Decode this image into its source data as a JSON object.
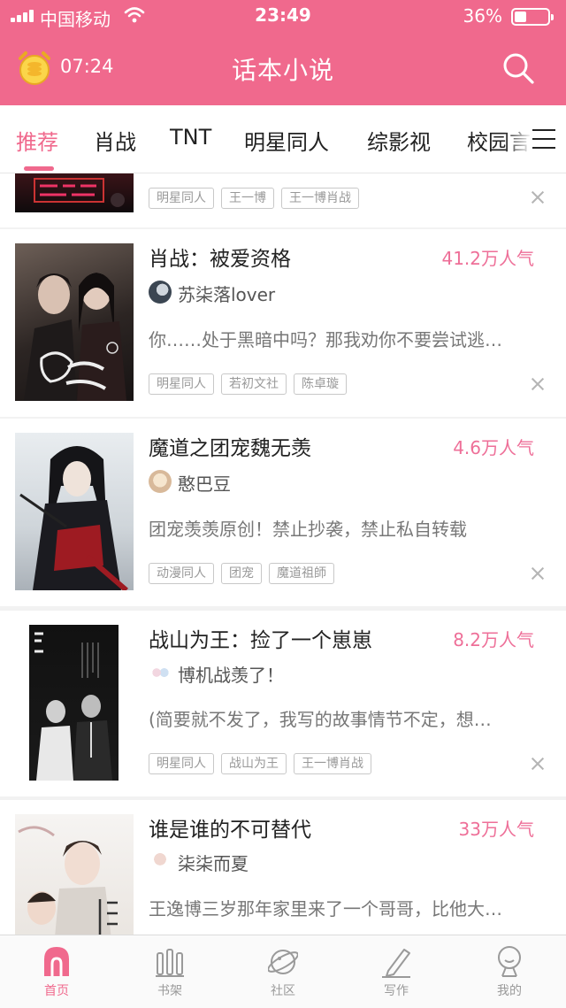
{
  "status_bar": {
    "carrier": "中国移动",
    "time": "23:49",
    "battery": "36%",
    "battery_level": 0.36
  },
  "app_bar": {
    "timer": "07:24",
    "title": "话本小说",
    "timer_icon": "coin-alarm-icon",
    "search_icon": "search-icon"
  },
  "tabs": [
    {
      "label": "推荐",
      "active": true
    },
    {
      "label": "肖战",
      "active": false
    },
    {
      "label": "TNT",
      "active": false
    },
    {
      "label": "明星同人",
      "active": false
    },
    {
      "label": "综影视",
      "active": false
    },
    {
      "label": "校园言",
      "active": false
    }
  ],
  "feed": [
    {
      "tags": [
        "明星同人",
        "王一博",
        "王一博肖战"
      ]
    },
    {
      "title": "肖战：被爱资格",
      "popularity": "41.2万人气",
      "author": "苏柒落lover",
      "description": "你……处于黑暗中吗？那我劝你不要尝试逃…",
      "tags": [
        "明星同人",
        "若初文社",
        "陈卓璇"
      ]
    },
    {
      "title": "魔道之团宠魏无羡",
      "popularity": "4.6万人气",
      "author": "憨巴豆",
      "description": "团宠羡羡原创！禁止抄袭，禁止私自转载",
      "tags": [
        "动漫同人",
        "团宠",
        "魔道祖師"
      ]
    },
    {
      "title": "战山为王：捡了一个崽崽",
      "popularity": "8.2万人气",
      "author": "博机战羡了！",
      "description": "(简要就不发了，我写的故事情节不定，想…",
      "tags": [
        "明星同人",
        "战山为王",
        "王一博肖战"
      ]
    },
    {
      "title": "谁是谁的不可替代",
      "popularity": "33万人气",
      "author": "柒柒而夏",
      "description": "王逸博三岁那年家里来了一个哥哥，比他大…"
    }
  ],
  "bottom_nav": [
    {
      "label": "首页",
      "icon": "home-arch-icon",
      "active": true
    },
    {
      "label": "书架",
      "icon": "bookshelf-icon",
      "active": false
    },
    {
      "label": "社区",
      "icon": "planet-icon",
      "active": false
    },
    {
      "label": "写作",
      "icon": "pen-icon",
      "active": false
    },
    {
      "label": "我的",
      "icon": "profile-icon",
      "active": false
    }
  ],
  "colors": {
    "accent": "#f0698d",
    "popularity": "#ee6f98",
    "tag_border": "#c8c8c8"
  }
}
